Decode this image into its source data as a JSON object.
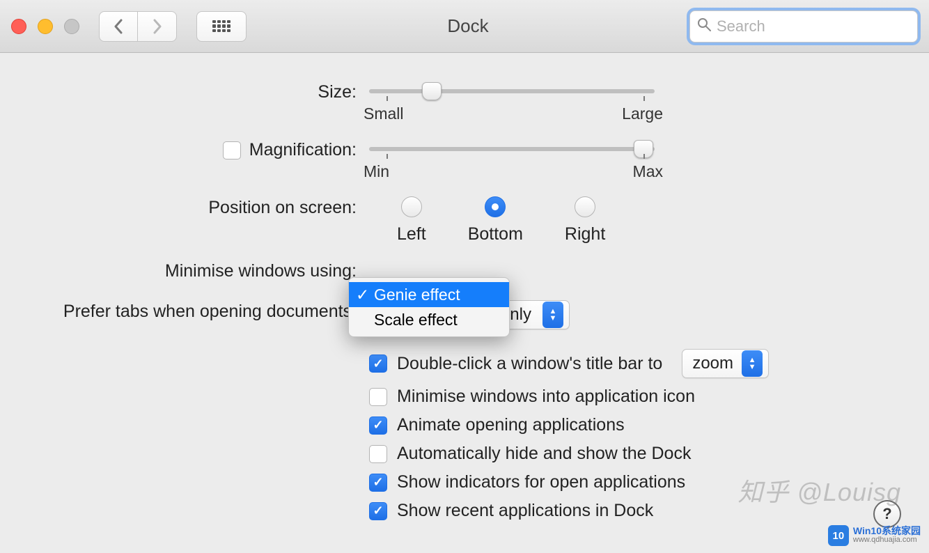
{
  "window": {
    "title": "Dock",
    "search_placeholder": "Search"
  },
  "settings": {
    "size": {
      "label": "Size:",
      "min_label": "Small",
      "max_label": "Large",
      "value_percent": 22
    },
    "magnification": {
      "label": "Magnification:",
      "enabled": false,
      "min_label": "Min",
      "max_label": "Max",
      "value_percent": 96
    },
    "position": {
      "label": "Position on screen:",
      "options": [
        "Left",
        "Bottom",
        "Right"
      ],
      "selected": "Bottom"
    },
    "minimize_effect": {
      "label": "Minimise windows using:",
      "options": [
        "Genie effect",
        "Scale effect"
      ],
      "selected": "Genie effect"
    },
    "prefer_tabs": {
      "label": "Prefer tabs when opening documents:",
      "visible_suffix": "Only"
    },
    "double_click": {
      "checked": true,
      "label": "Double-click a window's title bar to",
      "action": "zoom"
    },
    "checkboxes": [
      {
        "checked": false,
        "label": "Minimise windows into application icon"
      },
      {
        "checked": true,
        "label": "Animate opening applications"
      },
      {
        "checked": false,
        "label": "Automatically hide and show the Dock"
      },
      {
        "checked": true,
        "label": "Show indicators for open applications"
      },
      {
        "checked": true,
        "label": "Show recent applications in Dock"
      }
    ]
  },
  "watermark": {
    "text": "知乎 @Louisg",
    "site_title": "Win10系统家园",
    "site_url": "www.qdhuajia.com"
  }
}
